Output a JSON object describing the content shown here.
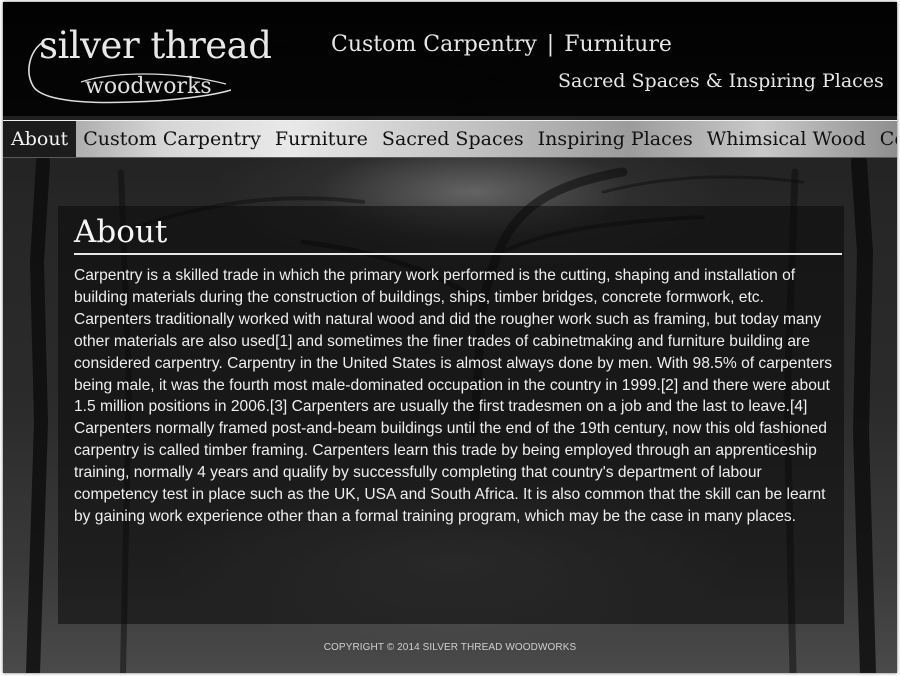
{
  "logo": {
    "line1": "silver thread",
    "line2": "woodworks"
  },
  "header": {
    "tagline_part1": "Custom Carpentry",
    "tagline_separator": "|",
    "tagline_part2": "Furniture",
    "tagline2": "Sacred Spaces & Inspiring Places"
  },
  "nav": {
    "items": [
      {
        "label": "About",
        "active": true
      },
      {
        "label": "Custom Carpentry"
      },
      {
        "label": "Furniture"
      },
      {
        "label": "Sacred Spaces"
      },
      {
        "label": "Inspiring Places"
      },
      {
        "label": "Whimsical Wood"
      },
      {
        "label": "Contact"
      }
    ]
  },
  "main": {
    "title": "About",
    "body": "Carpentry is a skilled trade in which the primary work performed is the cutting, shaping and installation of building materials during the construction of buildings, ships, timber bridges, concrete formwork, etc. Carpenters traditionally worked with natural wood and did the rougher work such as framing, but today many other materials are also used[1] and sometimes the finer trades of cabinetmaking and furniture building are considered carpentry. Carpentry in the United States is almost always done by men. With 98.5% of carpenters being male, it was the fourth most male-dominated occupation in the country in 1999.[2] and there were about 1.5 million positions in 2006.[3] Carpenters are usually the first tradesmen on a job and the last to leave.[4] Carpenters normally framed post-and-beam buildings until the end of the 19th century, now this old fashioned carpentry is called timber framing. Carpenters learn this trade by being employed through an apprenticeship training, normally 4 years and qualify by successfully completing that country's department of labour competency test in place such as the UK, USA and South Africa. It is also common that the skill can be learnt by gaining work experience other than a formal training program, which may be the case in many places."
  },
  "footer": {
    "copyright": "COPYRIGHT © 2014 SILVER THREAD WOODWORKS"
  },
  "colors": {
    "page_background": "#2a2a2a",
    "header_background": "#000000",
    "nav_background": "#cfcfcf",
    "nav_active_background": "#1c1c1c",
    "text_light": "#efefef"
  },
  "icons": {
    "logo": "swirl-logo"
  }
}
